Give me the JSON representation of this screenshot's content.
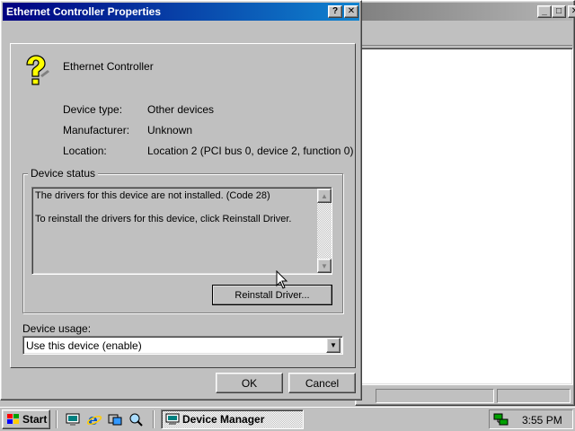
{
  "background_window": {
    "title": "",
    "controls": {
      "minimize": "_",
      "maximize": "□",
      "close": "✕"
    }
  },
  "dialog": {
    "title": "Ethernet Controller Properties",
    "help_button": "?",
    "close_button": "✕",
    "device_name": "Ethernet Controller",
    "properties": [
      {
        "label": "Device type:",
        "value": "Other devices"
      },
      {
        "label": "Manufacturer:",
        "value": "Unknown"
      },
      {
        "label": "Location:",
        "value": "Location 2 (PCI bus 0, device 2, function 0)"
      }
    ],
    "status_group_label": "Device status",
    "status_text_line1": "The drivers for this device are not installed. (Code 28)",
    "status_text_line2": "To reinstall the drivers for this device, click Reinstall Driver.",
    "reinstall_button": "Reinstall Driver...",
    "usage_label": "Device usage:",
    "usage_value": "Use this device (enable)",
    "ok_button": "OK",
    "cancel_button": "Cancel"
  },
  "taskbar": {
    "start_label": "Start",
    "task_label": "Device Manager",
    "clock": "3:55 PM",
    "quicklaunch_icons": [
      "desktop-icon",
      "internet-explorer-icon",
      "channels-icon",
      "search-icon"
    ]
  }
}
